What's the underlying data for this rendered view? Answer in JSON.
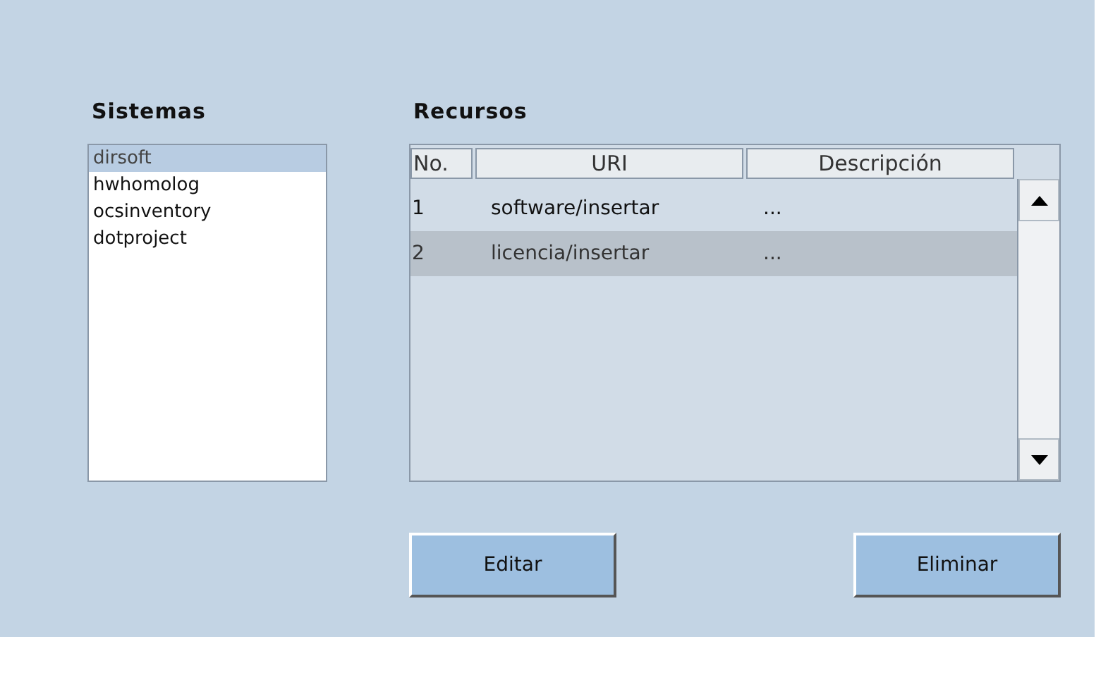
{
  "systems": {
    "title": "Sistemas",
    "items": [
      {
        "label": "dirsoft",
        "selected": true
      },
      {
        "label": "hwhomolog",
        "selected": false
      },
      {
        "label": "ocsinventory",
        "selected": false
      },
      {
        "label": "dotproject",
        "selected": false
      }
    ]
  },
  "resources": {
    "title": "Recursos",
    "table": {
      "columns": [
        "No.",
        "URI",
        "Descripción"
      ],
      "rows": [
        {
          "cells": [
            "1",
            "software/insertar",
            "..."
          ],
          "selected": false
        },
        {
          "cells": [
            "2",
            "licencia/insertar",
            "..."
          ],
          "selected": true
        }
      ]
    },
    "buttons": [
      "Editar",
      "Eliminar"
    ]
  }
}
